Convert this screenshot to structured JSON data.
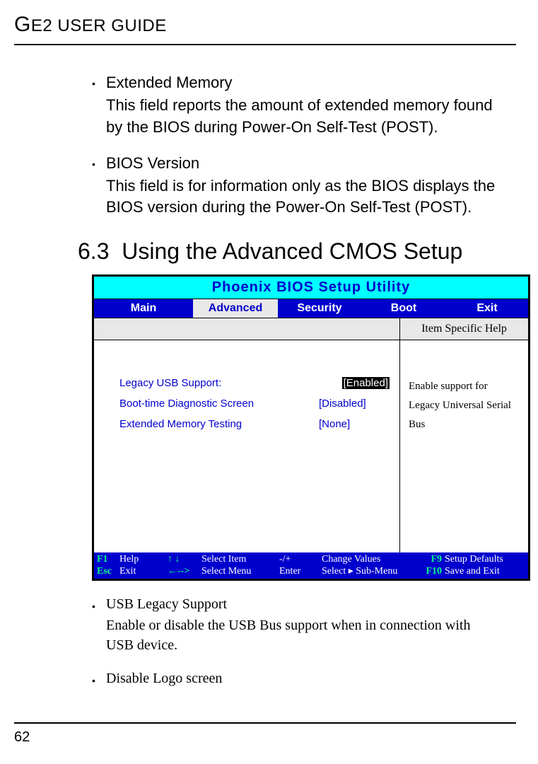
{
  "header": "GE2 USER GUIDE",
  "bullets_top": [
    {
      "title": "Extended Memory",
      "desc": "This field reports the amount of extended memory found by the BIOS during Power-On Self-Test (POST)."
    },
    {
      "title": "BIOS Version",
      "desc": "This field is for information only as the BIOS displays the BIOS version during the Power-On Self-Test (POST)."
    }
  ],
  "section_number": "6.3",
  "section_title": "Using the Advanced CMOS Setup",
  "bios": {
    "title": "Phoenix BIOS Setup Utility",
    "tabs": [
      "Main",
      "Advanced",
      "Security",
      "Boot",
      "Exit"
    ],
    "help_header": "Item Specific Help",
    "rows": [
      {
        "label": "Legacy USB Support:",
        "value": "[Enabled]",
        "selected": true
      },
      {
        "label": "Boot-time Diagnostic Screen",
        "value": "[Disabled]",
        "selected": false
      },
      {
        "label": "Extended Memory Testing",
        "value": "[None]",
        "selected": false
      }
    ],
    "help_text": [
      "Enable support for",
      "Legacy Universal Serial",
      "Bus"
    ],
    "footer": [
      {
        "key": "F1",
        "label": "Help",
        "arrows": "↑ ↓",
        "action": "Select Item",
        "sep": "-/+",
        "vals": "Change Values",
        "fk2": "F9",
        "end": "Setup Defaults"
      },
      {
        "key": "Esc",
        "label": "Exit",
        "arrows": "←-->",
        "action": "Select Menu",
        "sep": "Enter",
        "vals": "Select ▸ Sub-Menu",
        "fk2": "F10",
        "end": "Save and Exit"
      }
    ]
  },
  "bullets_bottom": [
    {
      "title": "USB Legacy Support",
      "desc": "Enable or disable the USB Bus support when in connection with USB device."
    },
    {
      "title": "Disable Logo screen",
      "desc": ""
    }
  ],
  "page_number": "62"
}
